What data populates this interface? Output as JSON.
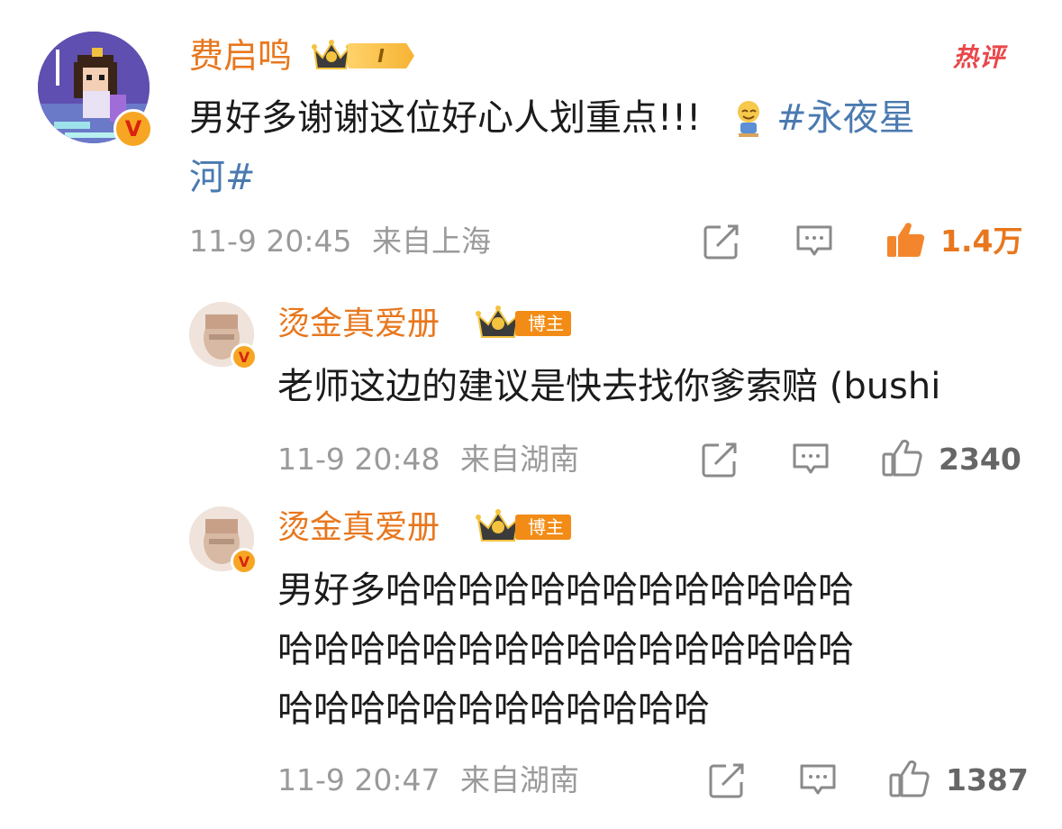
{
  "main_comment": {
    "user": "费启鸣",
    "level_badge": "I",
    "hot_label": "热评",
    "text_line1": "男好多谢谢这位好心人划重点!!!",
    "hashtag_part1": "#永夜星",
    "hashtag_part2": "河#",
    "time": "11-9 20:45",
    "location": "来自上海",
    "likes": "1.4万"
  },
  "replies": [
    {
      "user": "烫金真爱册",
      "tag": "博主",
      "text_lines": [
        "老师这边的建议是快去找你爹索赔 (bushi"
      ],
      "time": "11-9 20:48",
      "location": "来自湖南",
      "likes": "2340"
    },
    {
      "user": "烫金真爱册",
      "tag": "博主",
      "text_lines": [
        "男好多哈哈哈哈哈哈哈哈哈哈哈哈哈",
        "哈哈哈哈哈哈哈哈哈哈哈哈哈哈哈哈",
        "哈哈哈哈哈哈哈哈哈哈哈哈"
      ],
      "time": "11-9 20:47",
      "location": "来自湖南",
      "likes": "1387"
    }
  ],
  "colors": {
    "name": "#e8771d",
    "hashtag": "#4a7ab0",
    "meta": "#9a9a9a",
    "hot": "#e9474a",
    "liked": "#e8771d"
  },
  "icons": [
    "crown-icon",
    "verified-badge-icon",
    "repost-icon",
    "comment-icon",
    "like-icon",
    "emoji-smile-icon"
  ]
}
